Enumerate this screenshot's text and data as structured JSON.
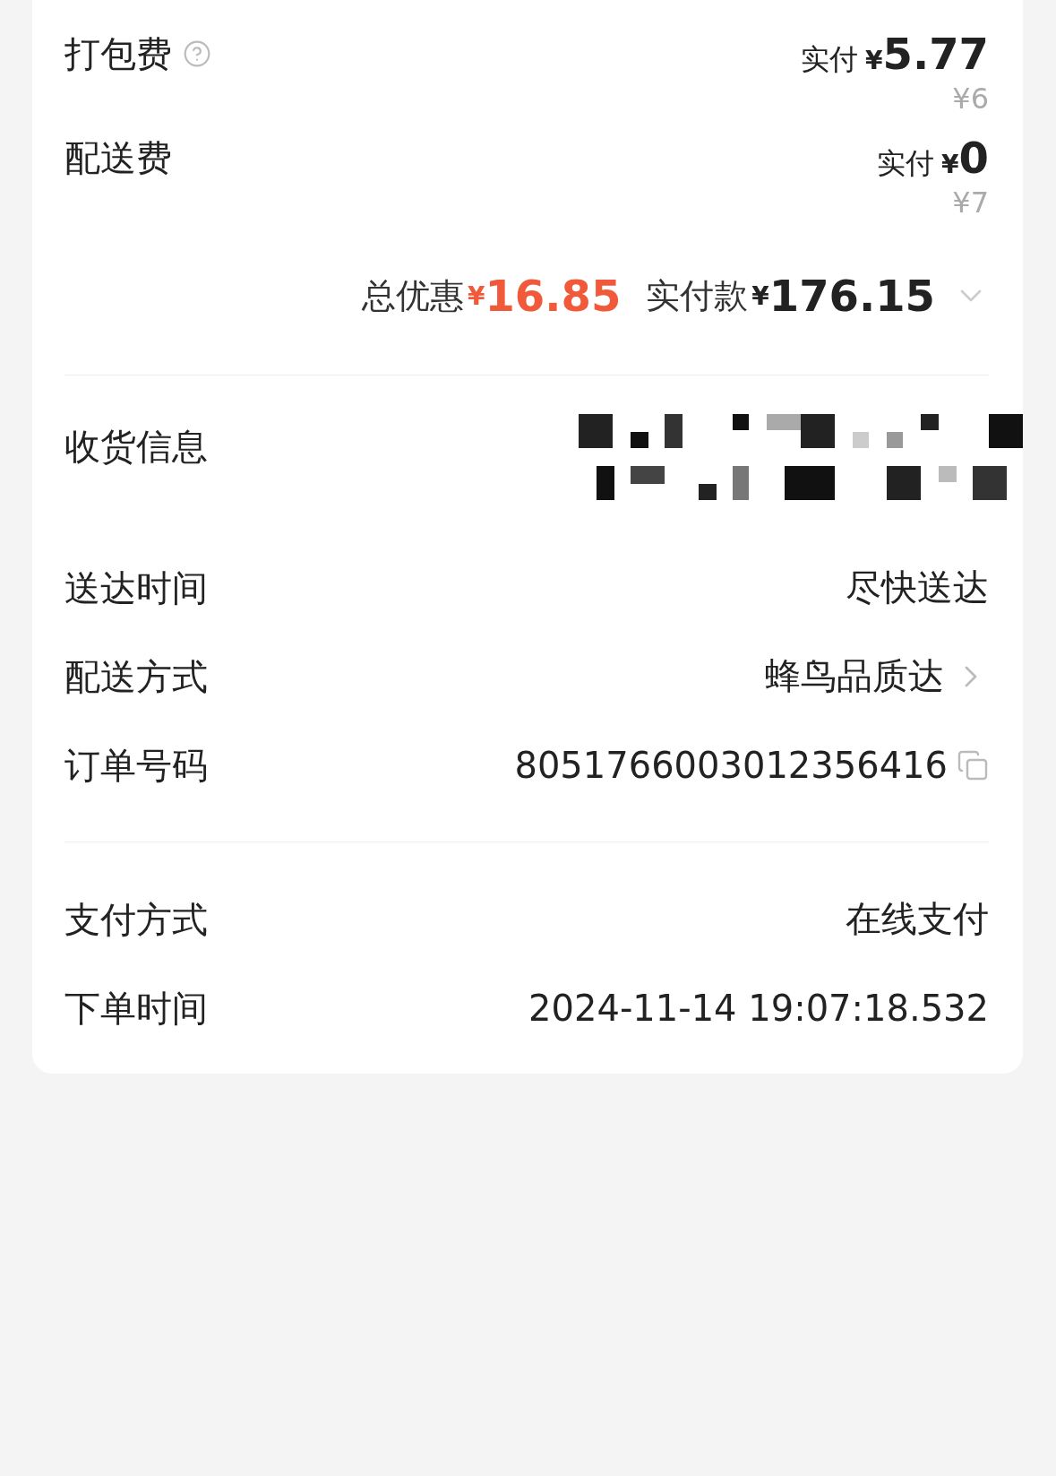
{
  "fees": [
    {
      "label": "打包费",
      "help": true,
      "paid_label": "实付",
      "currency": "¥",
      "paid": "5.77",
      "original": "¥6"
    },
    {
      "label": "配送费",
      "help": false,
      "paid_label": "实付",
      "currency": "¥",
      "paid": "0",
      "original": "¥7"
    }
  ],
  "summary": {
    "discount_label": "总优惠",
    "discount_currency": "¥",
    "discount": "16.85",
    "total_label": "实付款",
    "total_currency": "¥",
    "total": "176.15",
    "expanded": false
  },
  "delivery_info": [
    {
      "label": "收货信息",
      "kind": "redacted"
    },
    {
      "label": "送达时间",
      "kind": "text",
      "value": "尽快送达"
    },
    {
      "label": "配送方式",
      "kind": "link",
      "value": "蜂鸟品质达"
    },
    {
      "label": "订单号码",
      "kind": "copy",
      "value": "8051766003012356416"
    }
  ],
  "payment_info": [
    {
      "label": "支付方式",
      "kind": "text",
      "value": "在线支付"
    },
    {
      "label": "下单时间",
      "kind": "text",
      "value": "2024-11-14 19:07:18.532"
    }
  ]
}
